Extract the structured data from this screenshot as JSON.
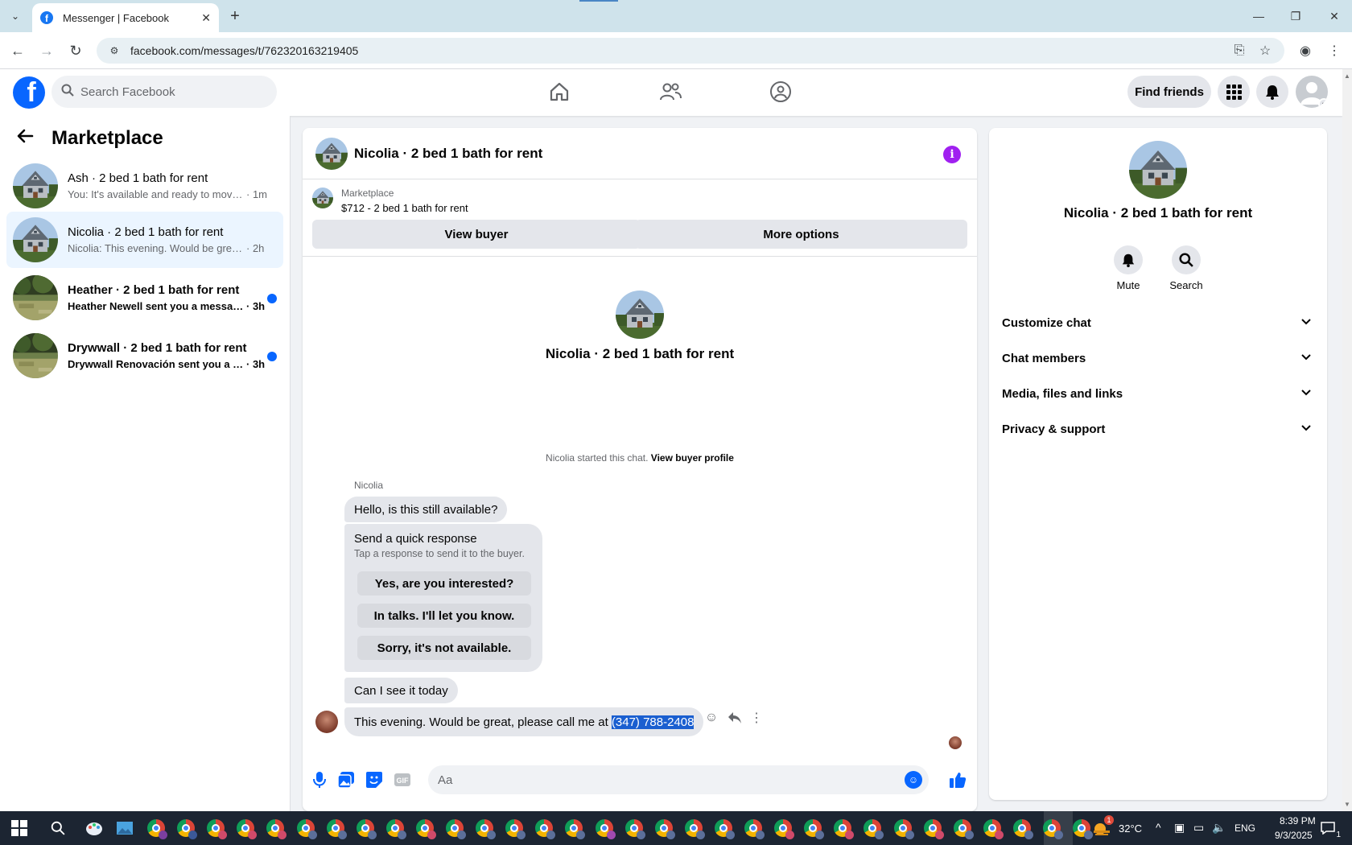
{
  "browser": {
    "tab_title": "Messenger | Facebook",
    "url": "facebook.com/messages/t/762320163219405"
  },
  "fb": {
    "search_placeholder": "Search Facebook",
    "find_friends": "Find friends"
  },
  "sidebar": {
    "title": "Marketplace",
    "conversations": [
      {
        "name": "Ash · 2 bed 1 bath for rent",
        "preview": "You: It's available and ready to move ...",
        "time": " · 1m",
        "unread": false,
        "active": false
      },
      {
        "name": "Nicolia · 2 bed 1 bath for rent",
        "preview": "Nicolia: This evening. Would be great,...",
        "time": " · 2h",
        "unread": false,
        "active": true
      },
      {
        "name": "Heather · 2 bed 1 bath for rent",
        "preview": "Heather Newell sent you a messag...",
        "time": " · 3h",
        "unread": true,
        "active": false
      },
      {
        "name": "Drywwall · 2 bed 1 bath for rent",
        "preview": "Drywwall Renovación sent you a m...",
        "time": " · 3h",
        "unread": true,
        "active": false
      }
    ]
  },
  "chat": {
    "title": "Nicolia · 2 bed 1 bath for rent",
    "listing_label": "Marketplace",
    "listing_price": "$712 - 2 bed 1 bath for rent",
    "view_buyer": "View buyer",
    "more_options": "More options",
    "intro_title": "Nicolia · 2 bed 1 bath for rent",
    "started_text": "Nicolia started this chat.",
    "view_buyer_profile": "View buyer profile",
    "sender_name": "Nicolia",
    "messages": {
      "m1": "Hello, is this still available?",
      "m2": "Can I see it today",
      "m3_text": "This evening. Would be great, please call me at",
      "m3_phone": "(347) 788-2408"
    },
    "quick_response": {
      "title": "Send a quick response",
      "subtitle": "Tap a response to send it to the buyer.",
      "options": [
        "Yes, are you interested?",
        "In talks. I'll let you know.",
        "Sorry, it's not available."
      ]
    },
    "composer_placeholder": "Aa"
  },
  "info_panel": {
    "name": "Nicolia · 2 bed 1 bath for rent",
    "mute": "Mute",
    "search": "Search",
    "sections": [
      "Customize chat",
      "Chat members",
      "Media, files and links",
      "Privacy & support"
    ]
  },
  "taskbar": {
    "temperature": "32°C",
    "language": "ENG",
    "time": "8:39 PM",
    "date": "9/3/2025",
    "weather_badge": "1",
    "notification_count": "1"
  },
  "colors": {
    "fb_blue": "#0866ff",
    "active_row": "#ebf5ff",
    "selection": "#1a5fd0",
    "info_purple": "#a020f0"
  }
}
